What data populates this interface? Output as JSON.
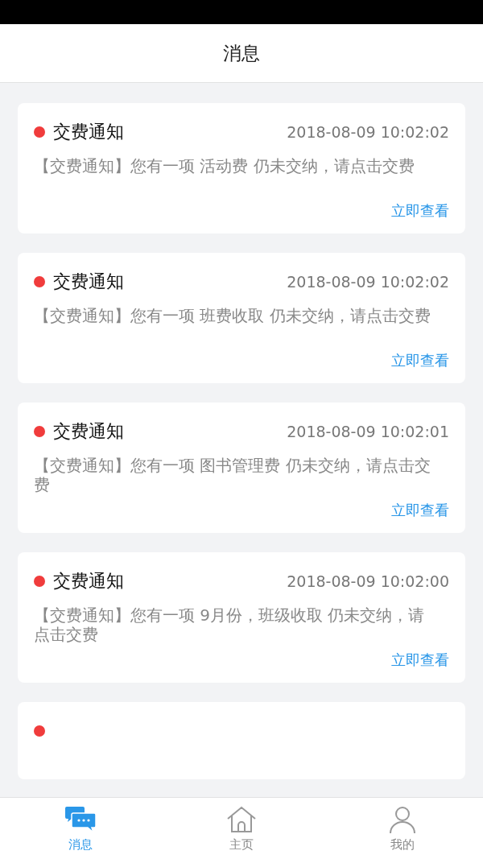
{
  "header": {
    "title": "消息"
  },
  "messages": [
    {
      "unread": true,
      "title": "交费通知",
      "time": "2018-08-09 10:02:02",
      "body": "【交费通知】您有一项 活动费 仍未交纳，请点击交费",
      "link": "立即查看"
    },
    {
      "unread": true,
      "title": "交费通知",
      "time": "2018-08-09 10:02:02",
      "body": "【交费通知】您有一项 班费收取 仍未交纳，请点击交费",
      "link": "立即查看"
    },
    {
      "unread": true,
      "title": "交费通知",
      "time": "2018-08-09 10:02:01",
      "body": "【交费通知】您有一项 图书管理费 仍未交纳，请点击交费",
      "link": "立即查看"
    },
    {
      "unread": true,
      "title": "交费通知",
      "time": "2018-08-09 10:02:00",
      "body": "【交费通知】您有一项 9月份，班级收取 仍未交纳，请点击交费",
      "link": "立即查看"
    },
    {
      "unread": true
    }
  ],
  "tabs": [
    {
      "kind": "messages",
      "label": "消息",
      "selected": true
    },
    {
      "kind": "home",
      "label": "主页",
      "selected": false
    },
    {
      "kind": "profile",
      "label": "我的",
      "selected": false
    }
  ]
}
